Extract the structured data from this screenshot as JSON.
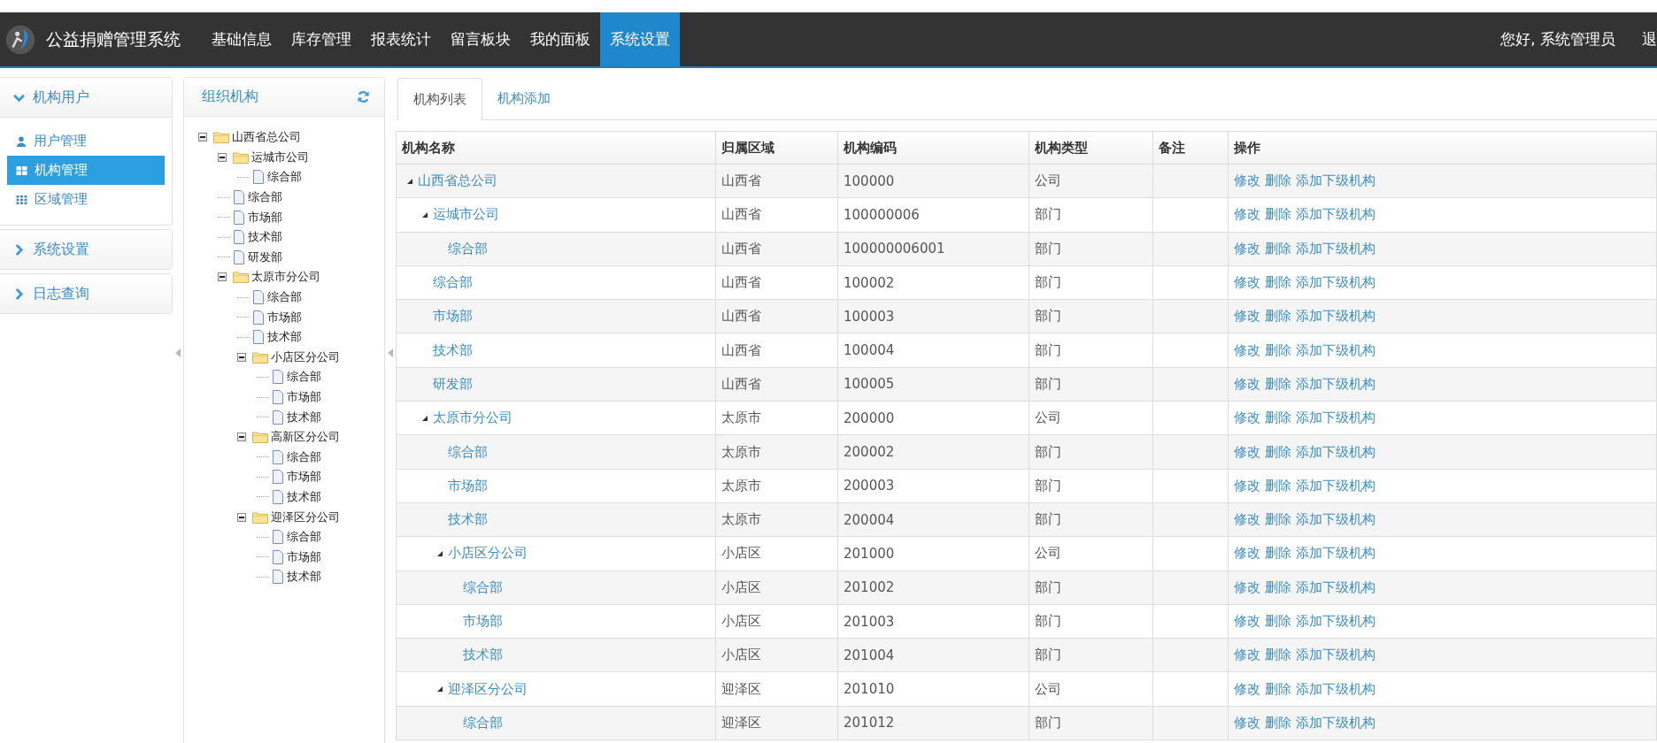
{
  "navbar": {
    "title": "公益捐赠管理系统",
    "menu": [
      {
        "label": "基础信息",
        "selected": false
      },
      {
        "label": "库存管理",
        "selected": false
      },
      {
        "label": "报表统计",
        "selected": false
      },
      {
        "label": "留言板块",
        "selected": false
      },
      {
        "label": "我的面板",
        "selected": false
      },
      {
        "label": "系统设置",
        "selected": true
      }
    ],
    "greeting": "您好, 系统管理员",
    "logout": "退"
  },
  "sidebar": {
    "groups": [
      {
        "title": "机构用户",
        "expanded": true,
        "items": [
          {
            "label": "用户管理",
            "selected": false
          },
          {
            "label": "机构管理",
            "selected": true
          },
          {
            "label": "区域管理",
            "selected": false
          }
        ]
      },
      {
        "title": "系统设置",
        "expanded": false
      },
      {
        "title": "日志查询",
        "expanded": false
      }
    ]
  },
  "org_tree": {
    "title": "组织机构",
    "nodes": [
      {
        "label": "山西省总公司",
        "kind": "folder",
        "expanded": true,
        "children": [
          {
            "label": "运城市公司",
            "kind": "folder",
            "expanded": true,
            "children": [
              {
                "label": "综合部",
                "kind": "file"
              }
            ]
          },
          {
            "label": "综合部",
            "kind": "file"
          },
          {
            "label": "市场部",
            "kind": "file"
          },
          {
            "label": "技术部",
            "kind": "file"
          },
          {
            "label": "研发部",
            "kind": "file"
          },
          {
            "label": "太原市分公司",
            "kind": "folder",
            "expanded": true,
            "children": [
              {
                "label": "综合部",
                "kind": "file"
              },
              {
                "label": "市场部",
                "kind": "file"
              },
              {
                "label": "技术部",
                "kind": "file"
              },
              {
                "label": "小店区分公司",
                "kind": "folder",
                "expanded": true,
                "children": [
                  {
                    "label": "综合部",
                    "kind": "file"
                  },
                  {
                    "label": "市场部",
                    "kind": "file"
                  },
                  {
                    "label": "技术部",
                    "kind": "file"
                  }
                ]
              },
              {
                "label": "高新区分公司",
                "kind": "folder",
                "expanded": true,
                "children": [
                  {
                    "label": "综合部",
                    "kind": "file"
                  },
                  {
                    "label": "市场部",
                    "kind": "file"
                  },
                  {
                    "label": "技术部",
                    "kind": "file"
                  }
                ]
              },
              {
                "label": "迎泽区分公司",
                "kind": "folder",
                "expanded": true,
                "children": [
                  {
                    "label": "综合部",
                    "kind": "file"
                  },
                  {
                    "label": "市场部",
                    "kind": "file"
                  },
                  {
                    "label": "技术部",
                    "kind": "file"
                  }
                ]
              }
            ]
          }
        ]
      }
    ]
  },
  "tabs": [
    {
      "label": "机构列表",
      "selected": true
    },
    {
      "label": "机构添加",
      "selected": false
    }
  ],
  "table": {
    "columns": [
      "机构名称",
      "归属区域",
      "机构编码",
      "机构类型",
      "备注",
      "操作"
    ],
    "rows": [
      {
        "name": "山西省总公司",
        "region": "山西省",
        "code": "100000",
        "type": "公司",
        "expanded": true,
        "actions": [
          "修改",
          "删除",
          "添加下级机构"
        ],
        "children": [
          {
            "name": "运城市公司",
            "region": "山西省",
            "code": "100000006",
            "type": "部门",
            "expanded": true,
            "actions": [
              "修改",
              "删除",
              "添加下级机构"
            ],
            "children": [
              {
                "name": "综合部",
                "region": "山西省",
                "code": "100000006001",
                "type": "部门",
                "actions": [
                  "修改",
                  "删除",
                  "添加下级机构"
                ]
              }
            ]
          },
          {
            "name": "综合部",
            "region": "山西省",
            "code": "100002",
            "type": "部门",
            "actions": [
              "修改",
              "删除",
              "添加下级机构"
            ]
          },
          {
            "name": "市场部",
            "region": "山西省",
            "code": "100003",
            "type": "部门",
            "actions": [
              "修改",
              "删除",
              "添加下级机构"
            ]
          },
          {
            "name": "技术部",
            "region": "山西省",
            "code": "100004",
            "type": "部门",
            "actions": [
              "修改",
              "删除",
              "添加下级机构"
            ]
          },
          {
            "name": "研发部",
            "region": "山西省",
            "code": "100005",
            "type": "部门",
            "actions": [
              "修改",
              "删除",
              "添加下级机构"
            ]
          },
          {
            "name": "太原市分公司",
            "region": "太原市",
            "code": "200000",
            "type": "公司",
            "expanded": true,
            "actions": [
              "修改",
              "删除",
              "添加下级机构"
            ],
            "children": [
              {
                "name": "综合部",
                "region": "太原市",
                "code": "200002",
                "type": "部门",
                "actions": [
                  "修改",
                  "删除",
                  "添加下级机构"
                ]
              },
              {
                "name": "市场部",
                "region": "太原市",
                "code": "200003",
                "type": "部门",
                "actions": [
                  "修改",
                  "删除",
                  "添加下级机构"
                ]
              },
              {
                "name": "技术部",
                "region": "太原市",
                "code": "200004",
                "type": "部门",
                "actions": [
                  "修改",
                  "删除",
                  "添加下级机构"
                ]
              },
              {
                "name": "小店区分公司",
                "region": "小店区",
                "code": "201000",
                "type": "公司",
                "expanded": true,
                "actions": [
                  "修改",
                  "删除",
                  "添加下级机构"
                ],
                "children": [
                  {
                    "name": "综合部",
                    "region": "小店区",
                    "code": "201002",
                    "type": "部门",
                    "actions": [
                      "修改",
                      "删除",
                      "添加下级机构"
                    ]
                  },
                  {
                    "name": "市场部",
                    "region": "小店区",
                    "code": "201003",
                    "type": "部门",
                    "actions": [
                      "修改",
                      "删除",
                      "添加下级机构"
                    ]
                  },
                  {
                    "name": "技术部",
                    "region": "小店区",
                    "code": "201004",
                    "type": "部门",
                    "actions": [
                      "修改",
                      "删除",
                      "添加下级机构"
                    ]
                  }
                ]
              },
              {
                "name": "迎泽区分公司",
                "region": "迎泽区",
                "code": "201010",
                "type": "公司",
                "expanded": true,
                "actions": [
                  "修改",
                  "删除",
                  "添加下级机构"
                ],
                "children": [
                  {
                    "name": "综合部",
                    "region": "迎泽区",
                    "code": "201012",
                    "type": "部门",
                    "actions": [
                      "修改",
                      "删除",
                      "添加下级机构"
                    ]
                  }
                ]
              }
            ]
          }
        ]
      }
    ]
  }
}
